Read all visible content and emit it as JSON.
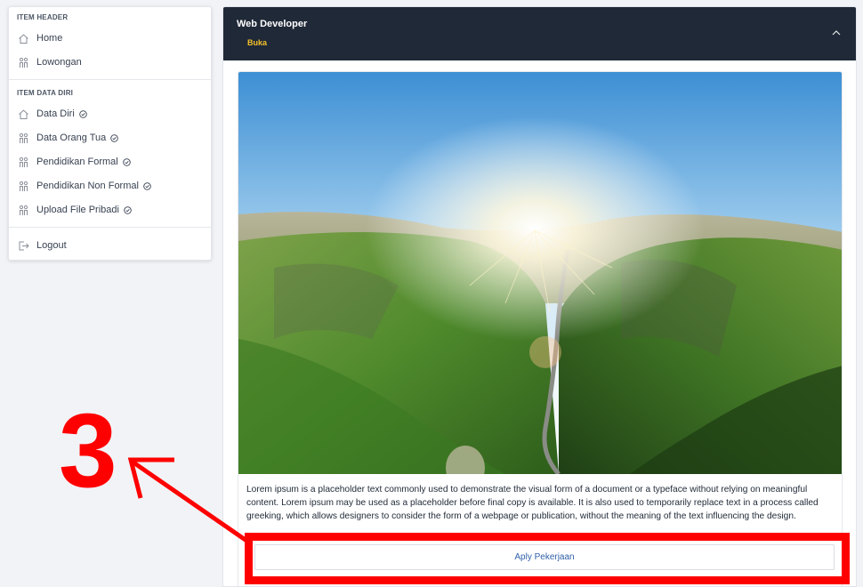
{
  "sidebar": {
    "header_section": {
      "label": "ITEM HEADER",
      "items": [
        {
          "label": "Home",
          "icon": "home-icon"
        },
        {
          "label": "Lowongan",
          "icon": "people-icon"
        }
      ]
    },
    "data_section": {
      "label": "ITEM DATA DIRI",
      "items": [
        {
          "label": "Data Diri",
          "icon": "home-icon",
          "completed": true
        },
        {
          "label": "Data Orang Tua",
          "icon": "people-icon",
          "completed": true
        },
        {
          "label": "Pendidikan Formal",
          "icon": "people-icon",
          "completed": true
        },
        {
          "label": "Pendidikan Non Formal",
          "icon": "people-icon",
          "completed": true
        },
        {
          "label": "Upload File Pribadi",
          "icon": "people-icon",
          "completed": true
        }
      ]
    },
    "logout": {
      "label": "Logout",
      "icon": "logout-icon"
    }
  },
  "job": {
    "title": "Web Developer",
    "status": "Buka",
    "status_color": "#f6c22b",
    "header_color": "#1f2937",
    "collapse_icon": "chevron-up-icon",
    "image": "valley-landscape-photo",
    "description": "Lorem ipsum is a placeholder text commonly used to demonstrate the visual form of a document or a typeface without relying on meaningful content. Lorem ipsum may be used as a placeholder before final copy is available. It is also used to temporarily replace text in a process called greeking, which allows designers to consider the form of a webpage or publication, without the meaning of the text influencing the design.",
    "apply_label": "Aply Pekerjaan"
  },
  "annotation": {
    "number": "3",
    "color": "#ff0000"
  }
}
